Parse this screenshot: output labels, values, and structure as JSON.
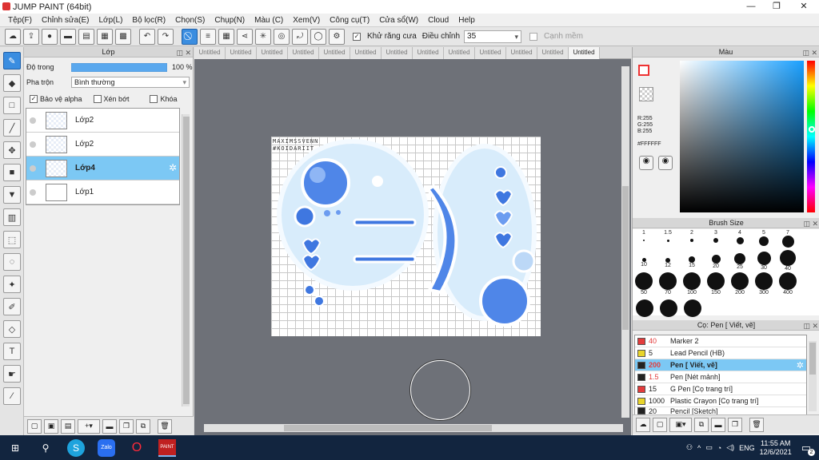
{
  "app": {
    "title": "JUMP PAINT (64bit)"
  },
  "menu": [
    "Tệp(F)",
    "Chỉnh sửa(E)",
    "Lớp(L)",
    "Bộ lọc(R)",
    "Chọn(S)",
    "Chụp(N)",
    "Màu (C)",
    "Xem(V)",
    "Công cụ(T)",
    "Cửa sổ(W)",
    "Cloud",
    "Help"
  ],
  "toolbar": {
    "antialias_label": "Khử răng cưa",
    "adjust_label": "Điều chỉnh",
    "adjust_value": "35",
    "sharp_label": "Cạnh mềm"
  },
  "layer_panel": {
    "title": "Lớp",
    "opacity_label": "Độ trong",
    "opacity_value": "100 %",
    "opacity_percent": 100,
    "blend_label": "Pha trộn",
    "blend_value": "Bình thường",
    "protect_alpha": "Bảo vệ alpha",
    "clip_label": "Xén bớt",
    "lock_label": "Khóa",
    "layers": [
      {
        "name": "Lớp2",
        "active": false
      },
      {
        "name": "Lớp2",
        "active": false
      },
      {
        "name": "Lớp4",
        "active": true
      },
      {
        "name": "Lớp1",
        "active": false
      }
    ]
  },
  "tabs": [
    "Untitled",
    "Untitled",
    "Untitled",
    "Untitled",
    "Untitled",
    "Untitled",
    "Untitled",
    "Untitled",
    "Untitled",
    "Untitled",
    "Untitled",
    "Untitled",
    "Untitled"
  ],
  "canvas": {
    "watermark_line1": "MAXIMSSVENN",
    "watermark_line2": "#KOIDARIIT"
  },
  "color_panel": {
    "title": "Màu",
    "r": "R:255",
    "g": "G:255",
    "b": "B:255",
    "hex": "#FFFFFF"
  },
  "brush_size": {
    "title": "Brush Size",
    "sizes": [
      "1",
      "1.5",
      "2",
      "3",
      "4",
      "5",
      "7",
      "10",
      "12",
      "15",
      "20",
      "25",
      "30",
      "40",
      "50",
      "70",
      "100",
      "150",
      "200",
      "300",
      "400"
    ]
  },
  "pen_panel": {
    "title": "Cọ: Pen [ Viết, vẽ]",
    "pens": [
      {
        "size": "40",
        "name": "Marker 2",
        "color": "#e33b3b",
        "active": false,
        "red": true
      },
      {
        "size": "5",
        "name": "Lead Pencil (HB)",
        "color": "#e8d42a",
        "active": false,
        "red": false
      },
      {
        "size": "200",
        "name": "Pen [ Viết, vẽ]",
        "color": "#222222",
        "active": true,
        "red": true
      },
      {
        "size": "1.5",
        "name": "Pen [Nét mảnh]",
        "color": "#222222",
        "active": false,
        "red": true
      },
      {
        "size": "15",
        "name": "G Pen [Cọ trang trí]",
        "color": "#e33b3b",
        "active": false,
        "red": false
      },
      {
        "size": "1000",
        "name": "Plastic Crayon [Cọ trang trí]",
        "color": "#e8d42a",
        "active": false,
        "red": false
      },
      {
        "size": "20",
        "name": "Pencil [Sketch]",
        "color": "#222222",
        "active": false,
        "red": false
      }
    ]
  },
  "taskbar": {
    "lang": "ENG",
    "time": "11:55 AM",
    "date": "12/6/2021",
    "notif": "2"
  },
  "colors": {
    "accent": "#3a8de0",
    "selection": "#7cc8f4",
    "taskbar": "#12253f"
  }
}
